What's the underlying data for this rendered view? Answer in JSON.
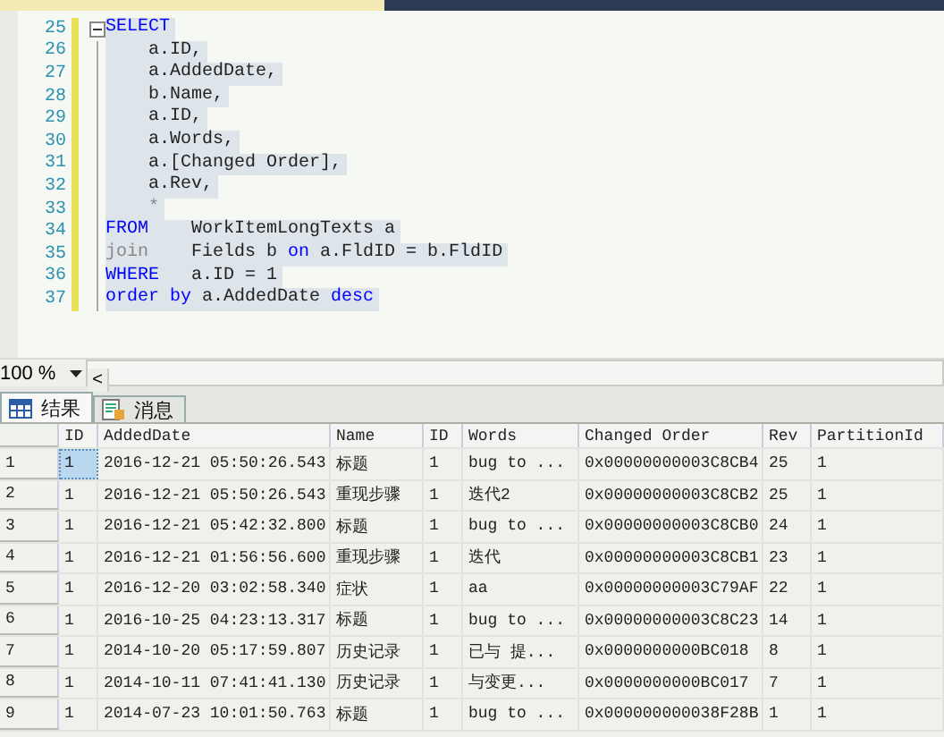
{
  "editor": {
    "lines": [
      {
        "number": "25",
        "fold": true,
        "segments": [
          {
            "kind": "keyword",
            "text": "SELECT"
          }
        ]
      },
      {
        "number": "26",
        "fold": false,
        "segments": [
          {
            "kind": "plain",
            "text": "    a.ID,"
          }
        ]
      },
      {
        "number": "27",
        "fold": false,
        "segments": [
          {
            "kind": "plain",
            "text": "    a.AddedDate,"
          }
        ]
      },
      {
        "number": "28",
        "fold": false,
        "segments": [
          {
            "kind": "plain",
            "text": "    b.Name,"
          }
        ]
      },
      {
        "number": "29",
        "fold": false,
        "segments": [
          {
            "kind": "plain",
            "text": "    a.ID,"
          }
        ]
      },
      {
        "number": "30",
        "fold": false,
        "segments": [
          {
            "kind": "plain",
            "text": "    a.Words,"
          }
        ]
      },
      {
        "number": "31",
        "fold": false,
        "segments": [
          {
            "kind": "plain",
            "text": "    a.[Changed Order],"
          }
        ]
      },
      {
        "number": "32",
        "fold": false,
        "segments": [
          {
            "kind": "plain",
            "text": "    a.Rev,"
          }
        ]
      },
      {
        "number": "33",
        "fold": false,
        "segments": [
          {
            "kind": "muted",
            "text": "    *"
          }
        ]
      },
      {
        "number": "34",
        "fold": false,
        "segments": [
          {
            "kind": "keyword",
            "text": "FROM"
          },
          {
            "kind": "plain",
            "text": "    WorkItemLongTexts a"
          }
        ]
      },
      {
        "number": "35",
        "fold": false,
        "segments": [
          {
            "kind": "muted",
            "text": "join"
          },
          {
            "kind": "plain",
            "text": "    Fields b "
          },
          {
            "kind": "keyword",
            "text": "on"
          },
          {
            "kind": "plain",
            "text": " a.FldID = b.FldID"
          }
        ]
      },
      {
        "number": "36",
        "fold": false,
        "segments": [
          {
            "kind": "keyword",
            "text": "WHERE"
          },
          {
            "kind": "plain",
            "text": "   a.ID = 1"
          }
        ]
      },
      {
        "number": "37",
        "fold": false,
        "segments": [
          {
            "kind": "keyword",
            "text": "order by"
          },
          {
            "kind": "plain",
            "text": " a.AddedDate "
          },
          {
            "kind": "keyword",
            "text": "desc"
          }
        ]
      }
    ]
  },
  "zoom": {
    "value": "100 %",
    "scroll_left": "<"
  },
  "result_tabs": [
    {
      "label": "结果",
      "selected": true
    },
    {
      "label": "消息",
      "selected": false
    }
  ],
  "grid": {
    "columns": [
      "ID",
      "AddedDate",
      "Name",
      "ID",
      "Words",
      "Changed Order",
      "Rev",
      "PartitionId"
    ],
    "rows": [
      {
        "row": "1",
        "selected": true,
        "cells": [
          "1",
          "2016-12-21 05:50:26.543",
          "标题",
          "1",
          "bug to ...",
          "0x00000000003C8CB4",
          "25",
          "1"
        ]
      },
      {
        "row": "2",
        "selected": false,
        "cells": [
          "1",
          "2016-12-21 05:50:26.543",
          "重现步骤",
          "1",
          "迭代2",
          "0x00000000003C8CB2",
          "25",
          "1"
        ]
      },
      {
        "row": "3",
        "selected": false,
        "cells": [
          "1",
          "2016-12-21 05:42:32.800",
          "标题",
          "1",
          "bug to ...",
          "0x00000000003C8CB0",
          "24",
          "1"
        ]
      },
      {
        "row": "4",
        "selected": false,
        "cells": [
          "1",
          "2016-12-21 01:56:56.600",
          "重现步骤",
          "1",
          "迭代",
          "0x00000000003C8CB1",
          "23",
          "1"
        ]
      },
      {
        "row": "5",
        "selected": false,
        "cells": [
          "1",
          "2016-12-20 03:02:58.340",
          "症状",
          "1",
          "aa",
          "0x00000000003C79AF",
          "22",
          "1"
        ]
      },
      {
        "row": "6",
        "selected": false,
        "cells": [
          "1",
          "2016-10-25 04:23:13.317",
          "标题",
          "1",
          "bug to ...",
          "0x00000000003C8C23",
          "14",
          "1"
        ]
      },
      {
        "row": "7",
        "selected": false,
        "cells": [
          "1",
          "2014-10-20 05:17:59.807",
          "历史记录",
          "1",
          "已与 提...",
          "0x0000000000BC018",
          "8",
          "1"
        ]
      },
      {
        "row": "8",
        "selected": false,
        "cells": [
          "1",
          "2014-10-11 07:41:41.130",
          "历史记录",
          "1",
          "与变更...",
          "0x0000000000BC017",
          "7",
          "1"
        ]
      },
      {
        "row": "9",
        "selected": false,
        "cells": [
          "1",
          "2014-07-23 10:01:50.763",
          "标题",
          "1",
          "bug to ...",
          "0x000000000038F28B",
          "1",
          "1"
        ]
      }
    ]
  }
}
